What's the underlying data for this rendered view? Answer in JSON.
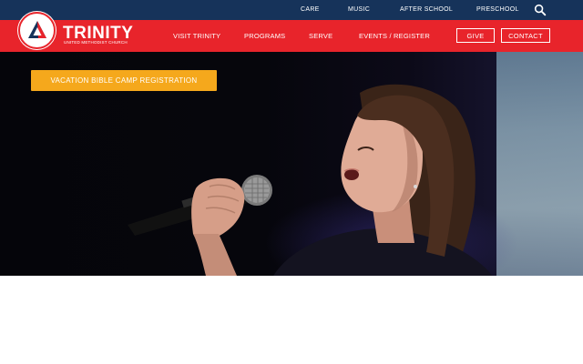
{
  "utility_nav": {
    "items": [
      {
        "label": "CARE"
      },
      {
        "label": "MUSIC"
      },
      {
        "label": "AFTER SCHOOL"
      },
      {
        "label": "PRESCHOOL"
      }
    ],
    "search_icon": "search-icon"
  },
  "brand": {
    "name": "TRINITY",
    "subtitle": "UNITED METHODIST CHURCH",
    "logo_icon": "triangle-logo-icon"
  },
  "main_nav": {
    "items": [
      {
        "label": "VISIT TRINITY"
      },
      {
        "label": "PROGRAMS"
      },
      {
        "label": "SERVE"
      },
      {
        "label": "EVENTS / REGISTER"
      }
    ],
    "give_label": "GIVE",
    "contact_label": "CONTACT"
  },
  "hero": {
    "cta_label": "VACATION BIBLE CAMP REGISTRATION",
    "image_subject": "girl singing into microphone"
  },
  "colors": {
    "utility_bar": "#16335a",
    "nav_red": "#e8242b",
    "cta_orange": "#f5a81c"
  }
}
